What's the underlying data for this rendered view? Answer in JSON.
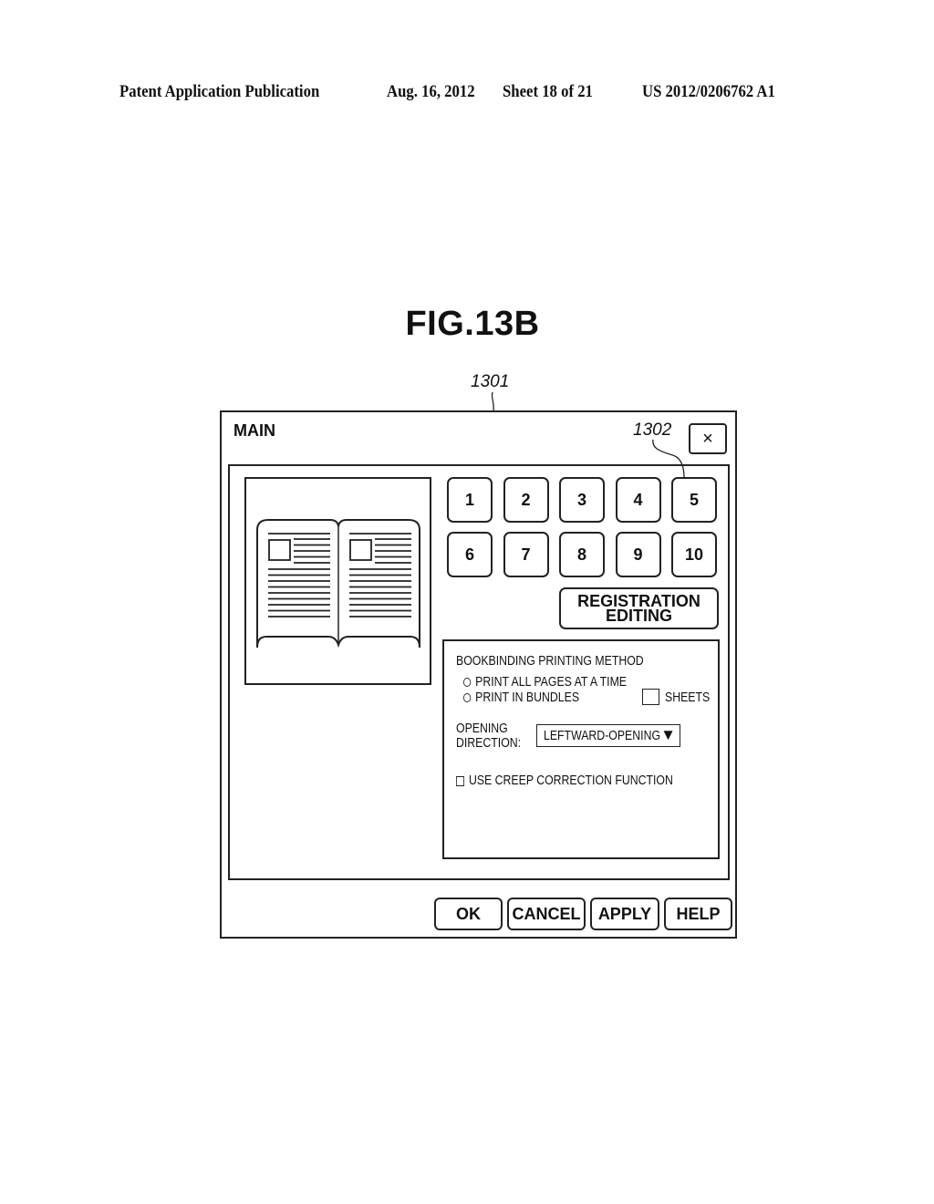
{
  "header": {
    "publication": "Patent Application Publication",
    "date": "Aug. 16, 2012",
    "sheet": "Sheet 18 of 21",
    "patent_number": "US 2012/0206762 A1"
  },
  "figure": {
    "title": "FIG.13B",
    "ref_window": "1301",
    "ref_button": "1302"
  },
  "dialog": {
    "title": "MAIN",
    "close_icon": "close-icon",
    "preview_icon": "open-book-icon",
    "registration_buttons": [
      "1",
      "2",
      "3",
      "4",
      "5",
      "6",
      "7",
      "8",
      "9",
      "10"
    ],
    "registration_editing": {
      "line1": "REGISTRATION",
      "line2": "EDITING"
    },
    "settings": {
      "heading": "BOOKBINDING PRINTING METHOD",
      "options": [
        "PRINT ALL PAGES AT A TIME",
        "PRINT IN BUNDLES"
      ],
      "sheets_label": "SHEETS",
      "sheets_value": "",
      "opening_label_line1": "OPENING",
      "opening_label_line2": "DIRECTION:",
      "opening_value": "LEFTWARD-OPENING",
      "dropdown_arrow": "▼",
      "creep_label": "USE CREEP CORRECTION FUNCTION"
    },
    "footer_buttons": {
      "ok": "OK",
      "cancel": "CANCEL",
      "apply": "APPLY",
      "help": "HELP"
    }
  }
}
